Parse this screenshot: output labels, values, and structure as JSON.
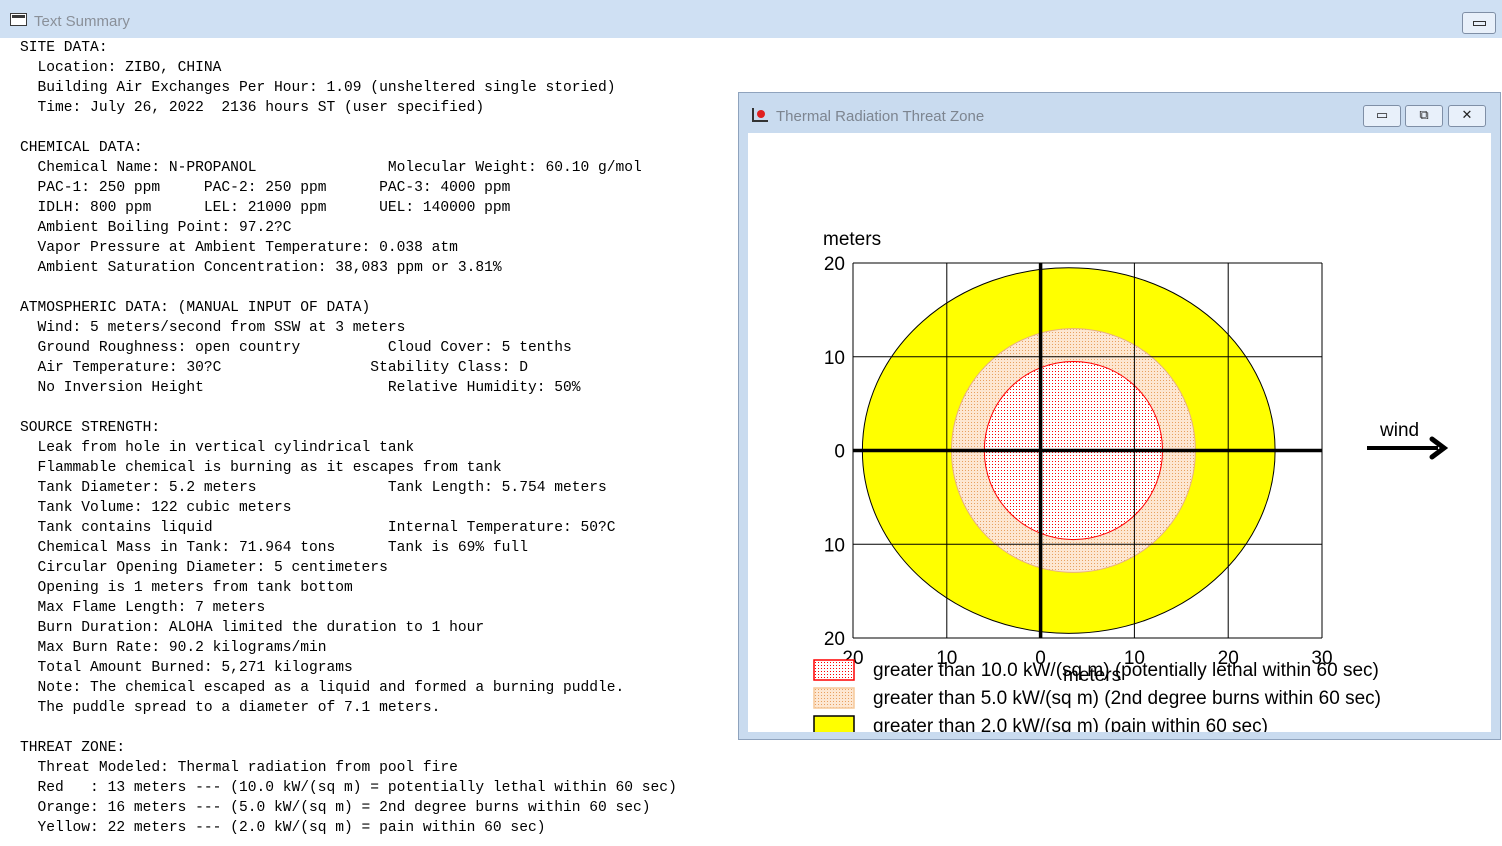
{
  "main_window": {
    "title": "Text Summary",
    "minimize_label": "▭"
  },
  "summary_lines": [
    "SITE DATA:",
    "  Location: ZIBO, CHINA",
    "  Building Air Exchanges Per Hour: 1.09 (unsheltered single storied)",
    "  Time: July 26, 2022  2136 hours ST (user specified)",
    "",
    "CHEMICAL DATA:",
    "  Chemical Name: N-PROPANOL               Molecular Weight: 60.10 g/mol",
    "  PAC-1: 250 ppm     PAC-2: 250 ppm      PAC-3: 4000 ppm",
    "  IDLH: 800 ppm      LEL: 21000 ppm      UEL: 140000 ppm",
    "  Ambient Boiling Point: 97.2?C",
    "  Vapor Pressure at Ambient Temperature: 0.038 atm",
    "  Ambient Saturation Concentration: 38,083 ppm or 3.81%",
    "",
    "ATMOSPHERIC DATA: (MANUAL INPUT OF DATA)",
    "  Wind: 5 meters/second from SSW at 3 meters",
    "  Ground Roughness: open country          Cloud Cover: 5 tenths",
    "  Air Temperature: 30?C                 Stability Class: D",
    "  No Inversion Height                     Relative Humidity: 50%",
    "",
    "SOURCE STRENGTH:",
    "  Leak from hole in vertical cylindrical tank",
    "  Flammable chemical is burning as it escapes from tank",
    "  Tank Diameter: 5.2 meters               Tank Length: 5.754 meters",
    "  Tank Volume: 122 cubic meters",
    "  Tank contains liquid                    Internal Temperature: 50?C",
    "  Chemical Mass in Tank: 71.964 tons      Tank is 69% full",
    "  Circular Opening Diameter: 5 centimeters",
    "  Opening is 1 meters from tank bottom",
    "  Max Flame Length: 7 meters",
    "  Burn Duration: ALOHA limited the duration to 1 hour",
    "  Max Burn Rate: 90.2 kilograms/min",
    "  Total Amount Burned: 5,271 kilograms",
    "  Note: The chemical escaped as a liquid and formed a burning puddle.",
    "  The puddle spread to a diameter of 7.1 meters.",
    "",
    "THREAT ZONE:",
    "  Threat Modeled: Thermal radiation from pool fire",
    "  Red   : 13 meters --- (10.0 kW/(sq m) = potentially lethal within 60 sec)",
    "  Orange: 16 meters --- (5.0 kW/(sq m) = 2nd degree burns within 60 sec)",
    "  Yellow: 22 meters --- (2.0 kW/(sq m) = pain within 60 sec)"
  ],
  "plot_window": {
    "title": "Thermal Radiation Threat Zone",
    "buttons": {
      "minimize": "▭",
      "restore": "⧉",
      "close": "✕"
    },
    "colors": {
      "red": "#ff0000",
      "orange": "#f5c89a",
      "yellow": "#ffff00",
      "grid": "#000000"
    },
    "wind_label": "wind"
  },
  "chart_data": {
    "type": "threat-zone",
    "xlabel": "meters",
    "ylabel": "meters",
    "xlim": [
      -20,
      30
    ],
    "ylim": [
      -20,
      20
    ],
    "x_ticks": [
      -20,
      -10,
      0,
      10,
      20,
      30
    ],
    "x_tick_labels": [
      "20",
      "10",
      "0",
      "10",
      "20",
      "30"
    ],
    "y_ticks": [
      20,
      10,
      0,
      -10,
      -20
    ],
    "y_tick_labels": [
      "20",
      "10",
      "0",
      "10",
      "20"
    ],
    "grid": true,
    "zones": [
      {
        "name": "yellow",
        "color": "#ffff00",
        "fill": "solid",
        "center_x": 3,
        "center_y": 0,
        "radius_x": 22,
        "radius_y": 19.5
      },
      {
        "name": "orange",
        "color": "#f5c89a",
        "fill": "dotted",
        "center_x": 3.5,
        "center_y": 0,
        "radius_x": 13,
        "radius_y": 13
      },
      {
        "name": "red",
        "color": "#ff0000",
        "fill": "dotted",
        "center_x": 3.5,
        "center_y": 0,
        "radius_x": 9.5,
        "radius_y": 9.5
      }
    ],
    "legend": [
      {
        "color": "#ff0000",
        "fill": "dotted",
        "label": "greater than 10.0 kW/(sq m) (potentially lethal within 60 sec)"
      },
      {
        "color": "#f5c89a",
        "fill": "dotted",
        "label": "greater than 5.0 kW/(sq m) (2nd degree burns within 60 sec)"
      },
      {
        "color": "#ffff00",
        "fill": "solid",
        "label": "greater than 2.0 kW/(sq m) (pain within 60 sec)"
      }
    ]
  }
}
